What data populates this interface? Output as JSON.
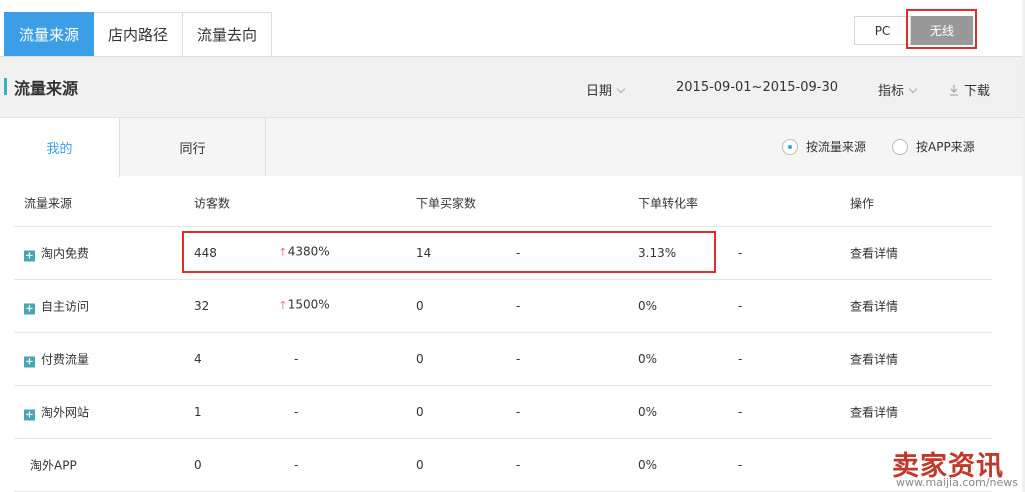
{
  "top_tabs": [
    "流量来源",
    "店内路径",
    "流量去向"
  ],
  "device": {
    "pc": "PC",
    "wireless": "无线"
  },
  "header": {
    "title": "流量来源",
    "date_label": "日期",
    "date_range": "2015-09-01~2015-09-30",
    "metric_label": "指标",
    "download_label": "下载"
  },
  "sub_tabs": {
    "mine": "我的",
    "peer": "同行"
  },
  "radios": {
    "by_traffic": "按流量来源",
    "by_app": "按APP来源",
    "selected": "by_traffic"
  },
  "table": {
    "headers": [
      "流量来源",
      "访客数",
      "下单买家数",
      "下单转化率",
      "操作"
    ],
    "rows": [
      {
        "source": "淘内免费",
        "visitors": "448",
        "visitors_change": "4380%",
        "buyers": "14",
        "buyers_change": "-",
        "rate": "3.13%",
        "rate_change": "-",
        "action": "查看详情",
        "expandable": true
      },
      {
        "source": "自主访问",
        "visitors": "32",
        "visitors_change": "1500%",
        "buyers": "0",
        "buyers_change": "-",
        "rate": "0%",
        "rate_change": "-",
        "action": "查看详情",
        "expandable": true
      },
      {
        "source": "付费流量",
        "visitors": "4",
        "visitors_change": "-",
        "buyers": "0",
        "buyers_change": "-",
        "rate": "0%",
        "rate_change": "-",
        "action": "查看详情",
        "expandable": true
      },
      {
        "source": "淘外网站",
        "visitors": "1",
        "visitors_change": "-",
        "buyers": "0",
        "buyers_change": "-",
        "rate": "0%",
        "rate_change": "-",
        "action": "查看详情",
        "expandable": true
      },
      {
        "source": "淘外APP",
        "visitors": "0",
        "visitors_change": "-",
        "buyers": "0",
        "buyers_change": "-",
        "rate": "0%",
        "rate_change": "-",
        "action": "",
        "expandable": false
      }
    ]
  },
  "watermark": {
    "title": "卖家资讯",
    "url": "www.maijia.com/news"
  },
  "colors": {
    "accent": "#3d9ee8",
    "highlight": "#e32b2b",
    "up": "#e34a4a"
  }
}
